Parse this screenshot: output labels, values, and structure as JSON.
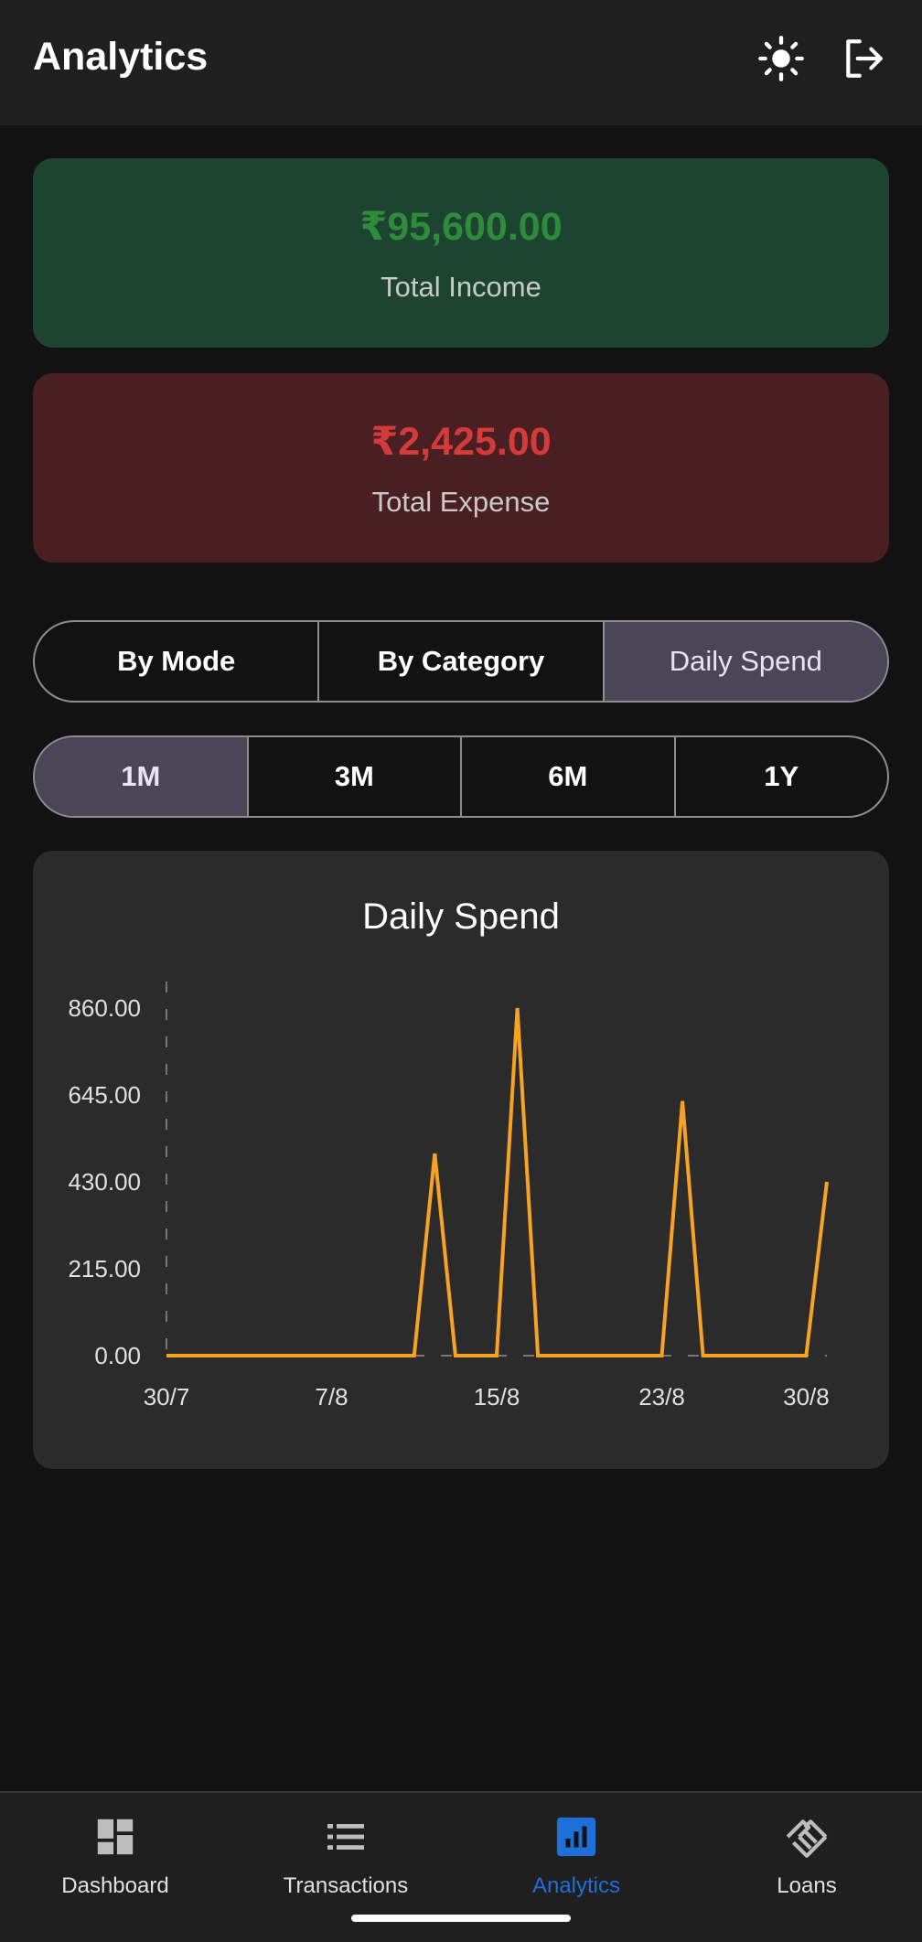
{
  "header": {
    "title": "Analytics",
    "icons": [
      "sun-icon",
      "logout-icon"
    ]
  },
  "summary": {
    "income": {
      "amount": "₹95,600.00",
      "label": "Total Income",
      "color": "#2e8b3a"
    },
    "expense": {
      "amount": "₹2,425.00",
      "label": "Total Expense",
      "color": "#d33a3a"
    }
  },
  "view_tabs": {
    "items": [
      "By Mode",
      "By Category",
      "Daily Spend"
    ],
    "selected": "Daily Spend"
  },
  "range_tabs": {
    "items": [
      "1M",
      "3M",
      "6M",
      "1Y"
    ],
    "selected": "1M"
  },
  "chart_data": {
    "type": "line",
    "title": "Daily Spend",
    "xlabel": "",
    "ylabel": "",
    "x_tick_labels": [
      "30/7",
      "7/8",
      "15/8",
      "23/8",
      "30/8"
    ],
    "y_tick_labels": [
      "860.00",
      "645.00",
      "430.00",
      "215.00",
      "0.00"
    ],
    "ylim": [
      0,
      860
    ],
    "x": [
      "30/7",
      "31/7",
      "1/8",
      "2/8",
      "3/8",
      "4/8",
      "5/8",
      "6/8",
      "7/8",
      "8/8",
      "9/8",
      "10/8",
      "11/8",
      "12/8",
      "13/8",
      "14/8",
      "15/8",
      "16/8",
      "17/8",
      "18/8",
      "19/8",
      "20/8",
      "21/8",
      "22/8",
      "23/8",
      "24/8",
      "25/8",
      "26/8",
      "27/8",
      "28/8",
      "29/8",
      "30/8",
      "31/8"
    ],
    "series": [
      {
        "values": [
          0,
          0,
          0,
          0,
          0,
          0,
          0,
          0,
          0,
          0,
          0,
          0,
          0,
          500,
          0,
          0,
          0,
          860,
          0,
          0,
          0,
          0,
          0,
          0,
          0,
          630,
          0,
          0,
          0,
          0,
          0,
          0,
          430
        ],
        "color": "#f5a225"
      }
    ],
    "grid": "dashed axis lines",
    "legend": "none"
  },
  "bottom_nav": {
    "items": [
      {
        "label": "Dashboard",
        "icon": "dashboard-icon"
      },
      {
        "label": "Transactions",
        "icon": "list-icon"
      },
      {
        "label": "Analytics",
        "icon": "analytics-icon"
      },
      {
        "label": "Loans",
        "icon": "handshake-icon"
      }
    ],
    "selected": "Analytics",
    "active_color": "#1e6fd9"
  }
}
